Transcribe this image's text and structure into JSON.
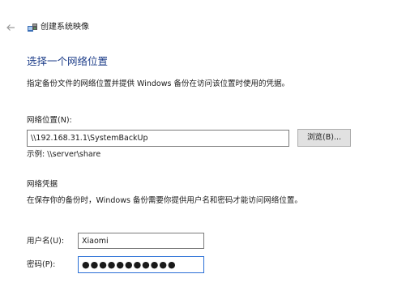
{
  "window": {
    "title": "创建系统映像",
    "back_icon": "back-arrow-icon",
    "app_icon": "backup-wizard-icon"
  },
  "page": {
    "heading": "选择一个网络位置",
    "description": "指定备份文件的网络位置并提供 Windows 备份在访问该位置时使用的凭据。"
  },
  "network_location": {
    "label": "网络位置(N):",
    "value": "\\\\192.168.31.1\\SystemBackUp",
    "browse_label": "浏览(B)...",
    "example": "示例: \\\\server\\share"
  },
  "credentials": {
    "heading": "网络凭据",
    "description": "在保存你的备份时，Windows 备份需要你提供用户名和密码才能访问网络位置。",
    "username_label": "用户名(U):",
    "username_value": "Xiaomi",
    "password_label": "密码(P):",
    "password_value": "●●●●●●●●●●●"
  },
  "colors": {
    "heading": "#1f3f8a",
    "focus_border": "#2a6fd6",
    "button_bg": "#e1e1e1"
  }
}
